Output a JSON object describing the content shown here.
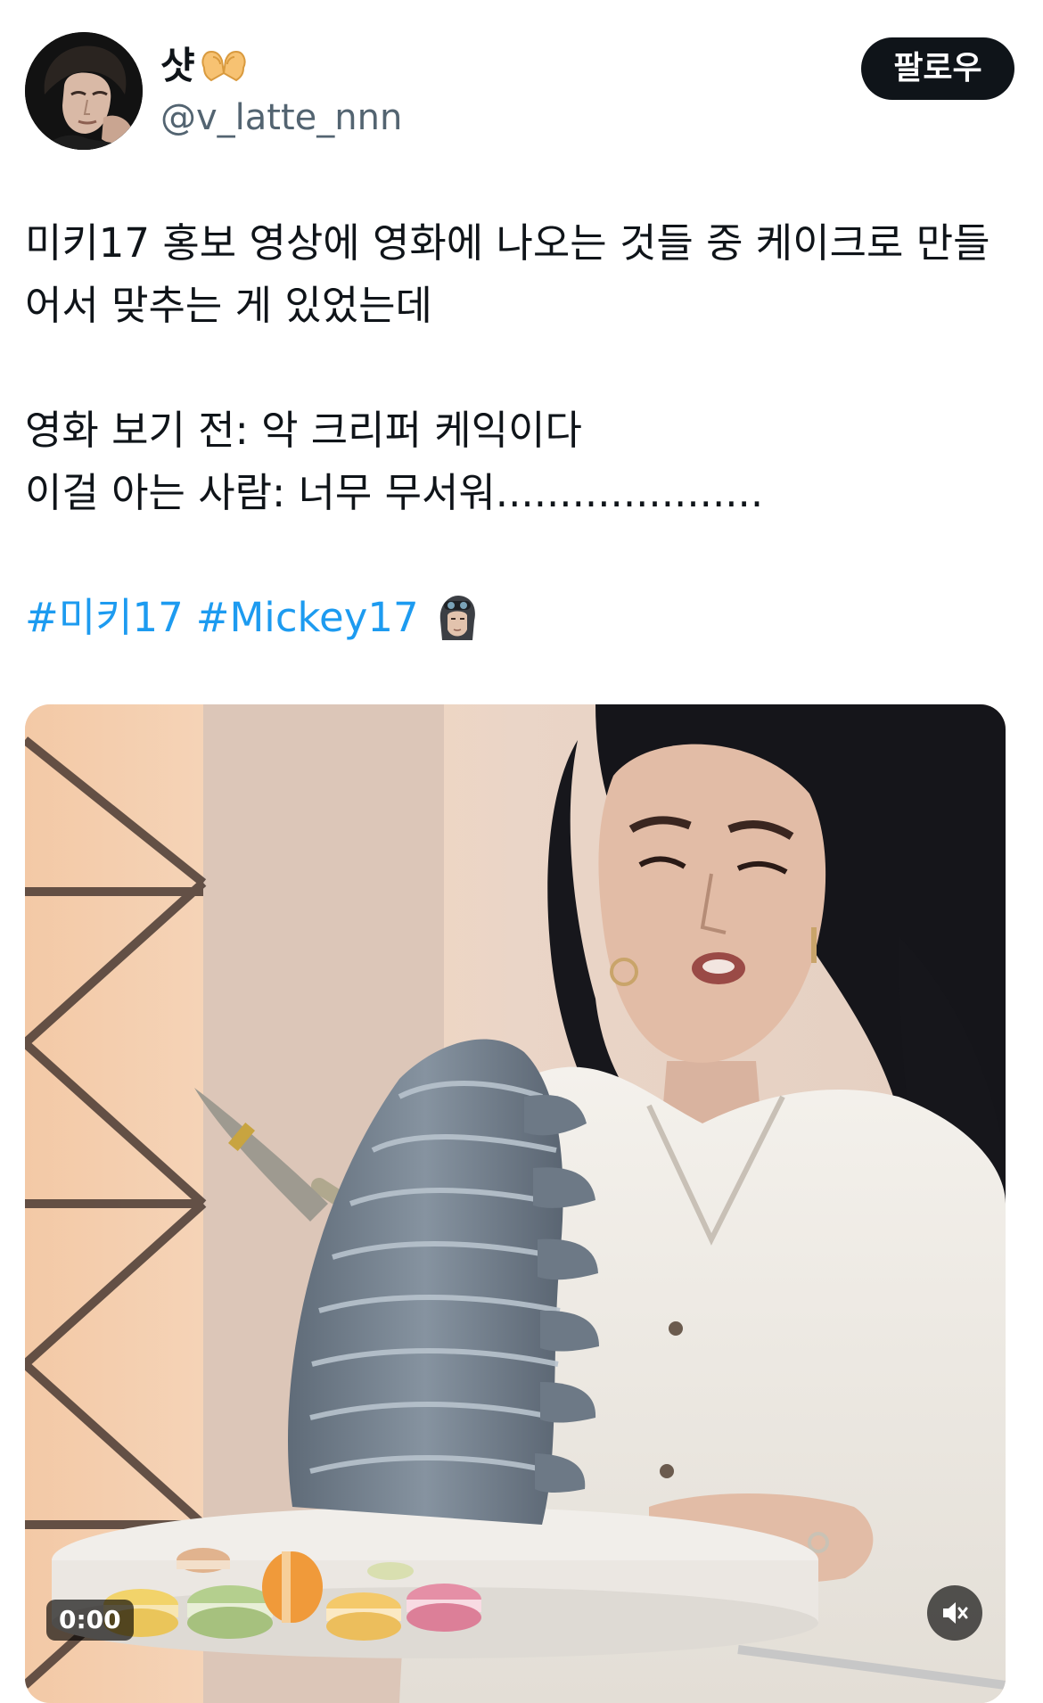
{
  "user": {
    "display_name": "샷",
    "handle": "@v_latte_nnn",
    "avatar_icon": "profile-photo",
    "name_emoji": "heart-hands-emoji"
  },
  "follow_button": {
    "label": "팔로우"
  },
  "tweet": {
    "line1": "미키17 홍보 영상에 영화에 나오는 것들 중 케이크로 만들",
    "line2": "어서 맞추는 게 있었는데",
    "line3": "영화 보기 전: 악 크리퍼 케익이다",
    "line4": "이걸 아는 사람: 너무 무서워.....................",
    "hashtags": [
      "#미키17",
      "#Mickey17"
    ],
    "trailing_emoji": "mickey17-hashflag-emoji",
    "link_color": "#1d9bf0"
  },
  "media": {
    "type": "video",
    "timestamp": "0:00",
    "mute_icon": "speaker-muted-icon"
  }
}
